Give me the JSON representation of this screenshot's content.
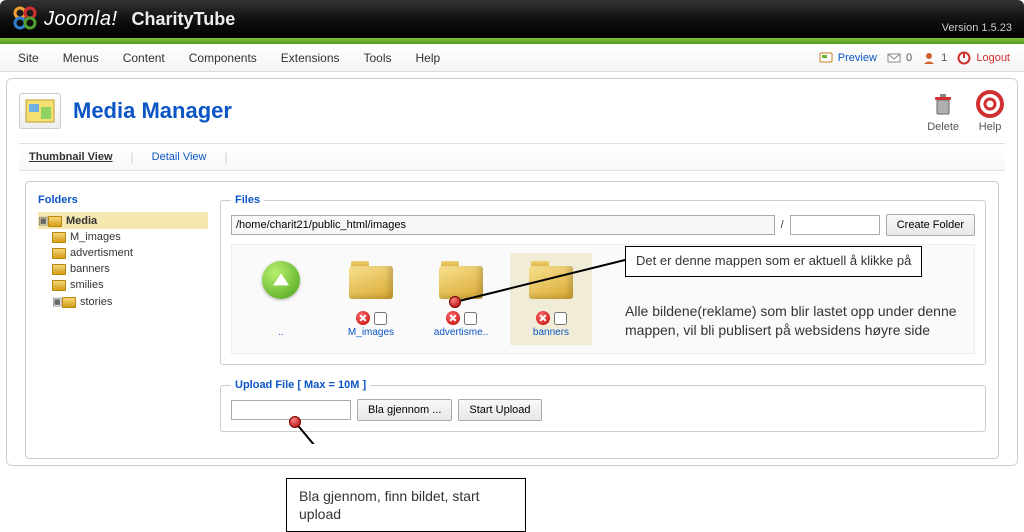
{
  "header": {
    "brand": "Joomla!",
    "site": "CharityTube",
    "version": "Version 1.5.23"
  },
  "menu": {
    "items": [
      "Site",
      "Menus",
      "Content",
      "Components",
      "Extensions",
      "Tools",
      "Help"
    ]
  },
  "status": {
    "preview": "Preview",
    "msg_count": "0",
    "user_count": "1",
    "logout": "Logout"
  },
  "page": {
    "title": "Media Manager"
  },
  "toolbar": {
    "delete": "Delete",
    "help": "Help"
  },
  "subtabs": {
    "thumb": "Thumbnail View",
    "detail": "Detail View"
  },
  "folders": {
    "label": "Folders",
    "root": "Media",
    "children": [
      "M_images",
      "advertisment",
      "banners",
      "smilies",
      "stories"
    ]
  },
  "files": {
    "legend": "Files",
    "path": "/home/charit21/public_html/images",
    "slash": "/",
    "newfolder_placeholder": "",
    "create_btn": "Create Folder",
    "up_name": "..",
    "items": [
      {
        "name": "M_images"
      },
      {
        "name": "advertisme.."
      },
      {
        "name": "banners"
      }
    ]
  },
  "upload": {
    "legend": "Upload File [ Max = 10M ]",
    "browse": "Bla gjennom ...",
    "start": "Start Upload"
  },
  "annotations": {
    "callout1_line1": "Det er denne mappen som er aktuell å klikke på",
    "callout1_line2": "Alle bildene(reklame) som blir lastet opp under denne mappen, vil bli publisert på websidens høyre side",
    "callout2": "Bla gjennom, finn bildet, start upload"
  }
}
